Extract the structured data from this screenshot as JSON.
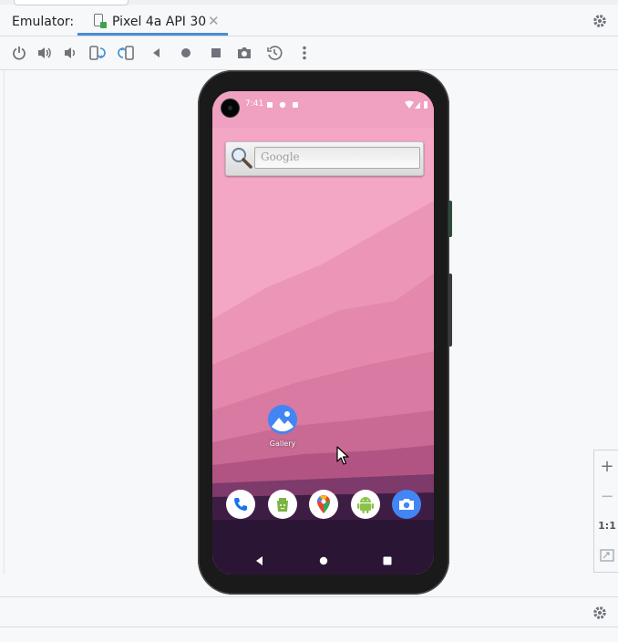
{
  "window": {
    "title": "Emulator:",
    "tabs": [
      {
        "label": "Pixel 4a API 30",
        "icon": "device-icon",
        "close_icon": "close-icon"
      }
    ],
    "settings_icon": "gear-icon"
  },
  "toolbar": {
    "buttons": [
      {
        "name": "power-icon"
      },
      {
        "name": "volume-up-icon"
      },
      {
        "name": "volume-down-icon"
      },
      {
        "name": "rotate-left-icon"
      },
      {
        "name": "rotate-right-icon"
      },
      {
        "name": "back-icon"
      },
      {
        "name": "home-icon"
      },
      {
        "name": "overview-icon"
      },
      {
        "name": "screenshot-icon"
      },
      {
        "name": "snapshot-icon"
      },
      {
        "name": "more-icon"
      }
    ]
  },
  "device": {
    "status_bar": {
      "time": "7:41"
    },
    "search_widget": {
      "placeholder": "Google",
      "icon": "magnifier-icon"
    },
    "home_apps": [
      {
        "label": "Gallery",
        "icon": "gallery-icon"
      }
    ],
    "dock": [
      {
        "name": "phone-icon"
      },
      {
        "name": "files-icon"
      },
      {
        "name": "maps-icon"
      },
      {
        "name": "android-icon"
      },
      {
        "name": "camera-icon"
      }
    ],
    "nav": [
      "back",
      "home",
      "recents"
    ]
  },
  "zoom": {
    "in": "+",
    "out": "−",
    "actual": "1:1",
    "fit_icon": "fit-screen-icon"
  },
  "colors": {
    "accent": "#4a8cd6",
    "wallpaper": "#f3a8c5",
    "dock_bg": "#2b1534"
  }
}
